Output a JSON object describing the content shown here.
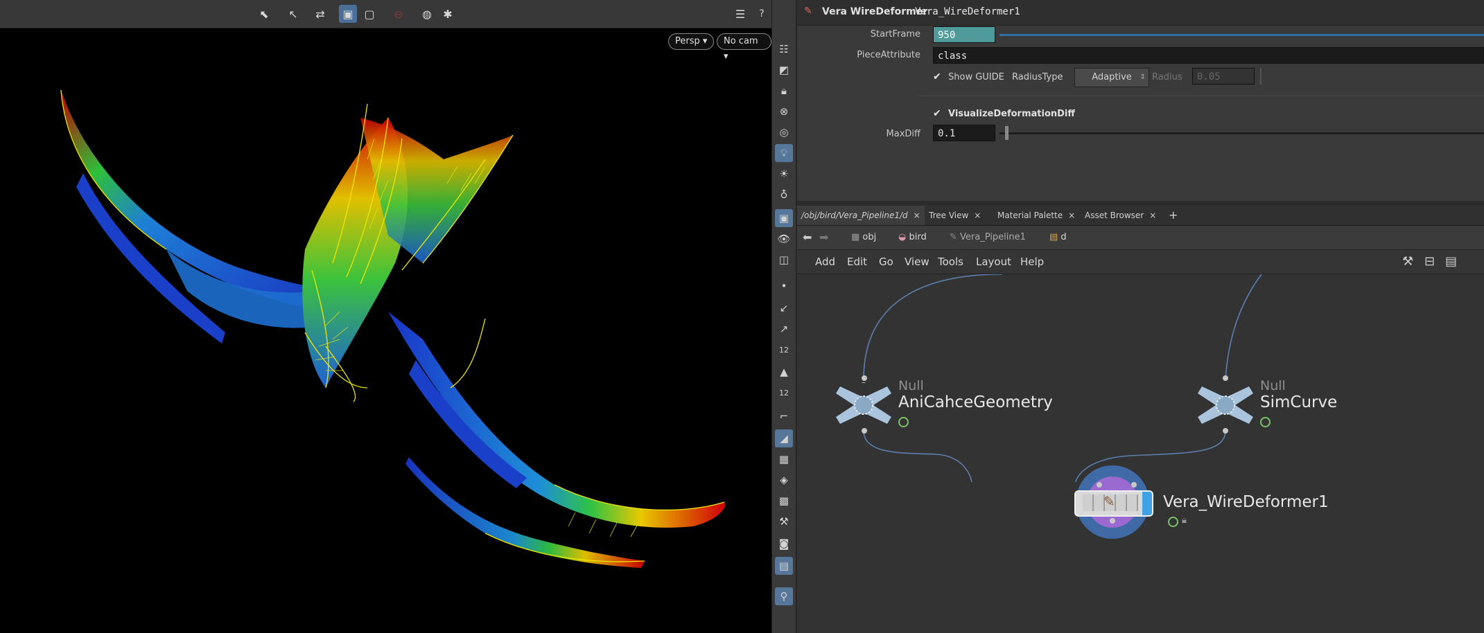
{
  "viewport": {
    "camera_menu": "Persp",
    "cam_menu": "No cam",
    "tool_icons": [
      "select-icon",
      "transform-icon",
      "handle-icon",
      "display-icon",
      "snapshot-icon",
      "record-icon",
      "camera-icon",
      "settings-icon",
      "view-layout-icon",
      "help-icon"
    ]
  },
  "shelf": {
    "badge_a": "12",
    "badge_b": "12"
  },
  "params": {
    "node_type": "Vera WireDeformer",
    "node_name": "Vera_WireDeformer1",
    "start_frame_label": "StartFrame",
    "start_frame_value": "950",
    "piece_attr_label": "PieceAttribute",
    "piece_attr_value": "class",
    "show_guide_label": "Show GUIDE",
    "radius_type_label": "RadiusType",
    "radius_type_value": "Adaptive",
    "radius_label": "Radius",
    "radius_value": "0.05",
    "visualize_label": "VisualizeDeformationDiff",
    "maxdiff_label": "MaxDiff",
    "maxdiff_value": "0.1"
  },
  "network": {
    "tabs": [
      {
        "label": "/obj/bird/Vera_Pipeline1/d",
        "close": "×"
      },
      {
        "label": "Tree View",
        "close": "×"
      },
      {
        "label": "Material Palette",
        "close": "×"
      },
      {
        "label": "Asset Browser",
        "close": "×"
      }
    ],
    "add_tab": "+",
    "path": [
      "obj",
      "bird",
      "Vera_Pipeline1",
      "d"
    ],
    "menu": [
      "Add",
      "Edit",
      "Go",
      "View",
      "Tools",
      "Layout",
      "Help"
    ],
    "nodes": [
      {
        "type": "Null",
        "name": "AniCahceGeometry"
      },
      {
        "type": "Null",
        "name": "SimCurve"
      },
      {
        "type": "",
        "name": "Vera_WireDeformer1"
      }
    ],
    "colors": {
      "selected_node": "#4c8fd6",
      "wire": "#5c7fae",
      "node_ring": "#9a6ad0"
    }
  }
}
